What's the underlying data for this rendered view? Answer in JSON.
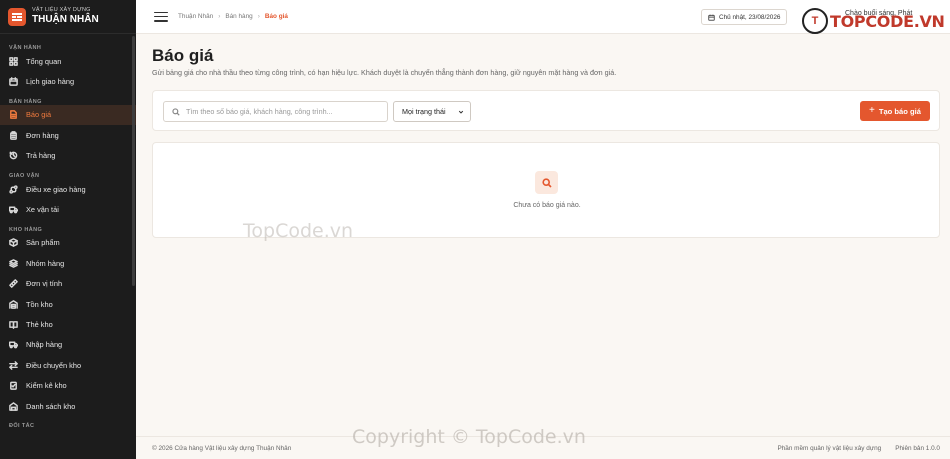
{
  "brand": {
    "subtitle": "VẬT LIỆU XÂY DỰNG",
    "name": "THUẬN NHÂN"
  },
  "sidebar": {
    "sections": [
      {
        "title": "VẬN HÀNH",
        "items": [
          {
            "label": "Tổng quan",
            "icon": "dashboard-icon"
          },
          {
            "label": "Lịch giao hàng",
            "icon": "calendar-icon"
          }
        ]
      },
      {
        "title": "BÁN HÀNG",
        "items": [
          {
            "label": "Báo giá",
            "icon": "file-icon",
            "active": true
          },
          {
            "label": "Đơn hàng",
            "icon": "clipboard-icon"
          },
          {
            "label": "Trả hàng",
            "icon": "history-icon"
          }
        ]
      },
      {
        "title": "GIAO VẬN",
        "items": [
          {
            "label": "Điều xe giao hàng",
            "icon": "route-icon"
          },
          {
            "label": "Xe vận tải",
            "icon": "truck-icon"
          }
        ]
      },
      {
        "title": "KHO HÀNG",
        "items": [
          {
            "label": "Sản phẩm",
            "icon": "package-icon"
          },
          {
            "label": "Nhóm hàng",
            "icon": "layers-icon"
          },
          {
            "label": "Đơn vị tính",
            "icon": "ruler-icon"
          },
          {
            "label": "Tồn kho",
            "icon": "warehouse-icon"
          },
          {
            "label": "Thẻ kho",
            "icon": "book-icon"
          },
          {
            "label": "Nhập hàng",
            "icon": "truck-in-icon"
          },
          {
            "label": "Điều chuyển kho",
            "icon": "transfer-icon"
          },
          {
            "label": "Kiểm kê kho",
            "icon": "checklist-icon"
          },
          {
            "label": "Danh sách kho",
            "icon": "building-icon"
          }
        ]
      },
      {
        "title": "ĐỐI TÁC",
        "items": []
      }
    ]
  },
  "header": {
    "breadcrumb": [
      "Thuận Nhân",
      "Bán hàng",
      "Báo giá"
    ],
    "date": "Chủ nhật, 23/08/2026",
    "greeting": "Chào buổi sáng, Phát",
    "logo_text": "TOPCODE.VN"
  },
  "main": {
    "title": "Báo giá",
    "description": "Gửi bảng giá cho nhà thầu theo từng công trình, có hạn hiệu lực. Khách duyệt là chuyển thẳng thành đơn hàng, giữ nguyên mặt hàng và đơn giá.",
    "search_placeholder": "Tìm theo số báo giá, khách hàng, công trình...",
    "status_select": "Mọi trạng thái",
    "create_button": "Tạo báo giá",
    "empty_text": "Chưa có báo giá nào."
  },
  "watermarks": {
    "mid": "TopCode.vn",
    "bottom": "Copyright © TopCode.vn"
  },
  "footer": {
    "copyright": "© 2026 Cửa hàng Vật liệu xây dựng Thuận Nhân",
    "software": "Phần mềm quản lý vật liệu xây dựng",
    "version": "Phiên bản 1.0.0"
  },
  "colors": {
    "accent": "#e4572e",
    "sidebar_bg": "#1c1c1c",
    "page_bg": "#faf7f3"
  }
}
